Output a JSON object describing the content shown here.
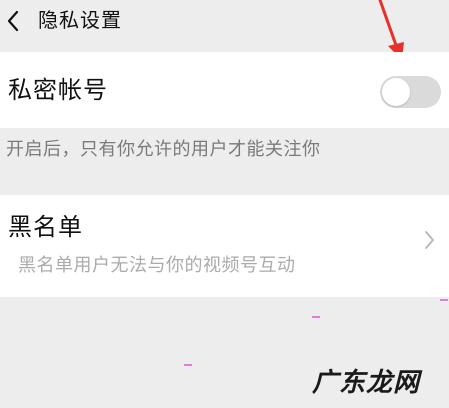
{
  "header": {
    "title": "隐私设置",
    "back_icon": "chevron-left-icon"
  },
  "private_account": {
    "label": "私密帐号",
    "toggle_on": false,
    "hint": "开启后，只有你允许的用户才能关注你"
  },
  "blacklist": {
    "label": "黑名单",
    "description": "黑名单用户无法与你的视频号互动",
    "chevron_icon": "chevron-right-icon"
  },
  "annotation": {
    "arrow_color": "#e8302a"
  },
  "watermark": {
    "text": "广东龙网"
  },
  "colors": {
    "background": "#ededed",
    "card": "#ffffff",
    "toggle_off": "#dadada",
    "primary_text": "#111111",
    "secondary_text": "#7a7a7a"
  }
}
